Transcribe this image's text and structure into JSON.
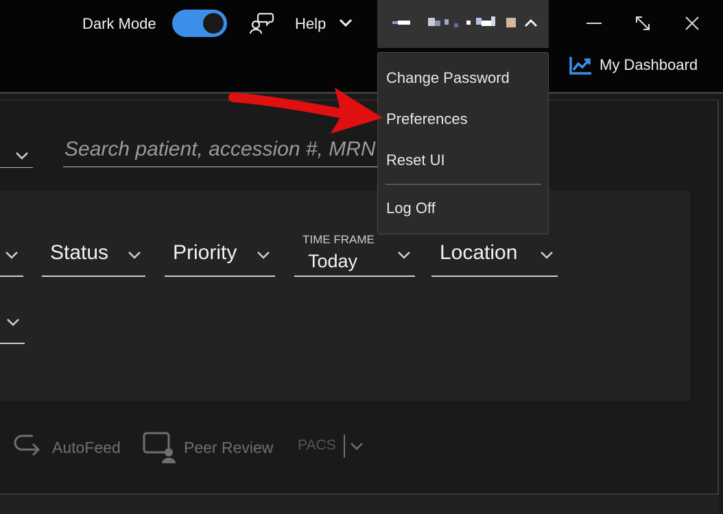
{
  "header": {
    "dark_mode_label": "Dark Mode",
    "dark_mode_enabled": true,
    "help_label": "Help",
    "user_menu_expanded": true
  },
  "user_menu": {
    "items": [
      {
        "label": "Change Password"
      },
      {
        "label": "Preferences"
      },
      {
        "label": "Reset UI"
      },
      {
        "label": "Log Off"
      }
    ]
  },
  "dashboard": {
    "label": "My Dashboard"
  },
  "search": {
    "placeholder": "Search patient, accession #, MRN"
  },
  "filters": {
    "status_label": "Status",
    "priority_label": "Priority",
    "time_frame_caption": "TIME FRAME",
    "time_frame_value": "Today",
    "location_label": "Location"
  },
  "toolbar": {
    "autofeed_label": "AutoFeed",
    "peer_review_label": "Peer Review",
    "pacs_label": "PACS"
  },
  "colors": {
    "accent": "#3b8fe8",
    "annotation_arrow": "#e01010",
    "background": "#141414",
    "disabled_text": "#6f6f6f"
  }
}
